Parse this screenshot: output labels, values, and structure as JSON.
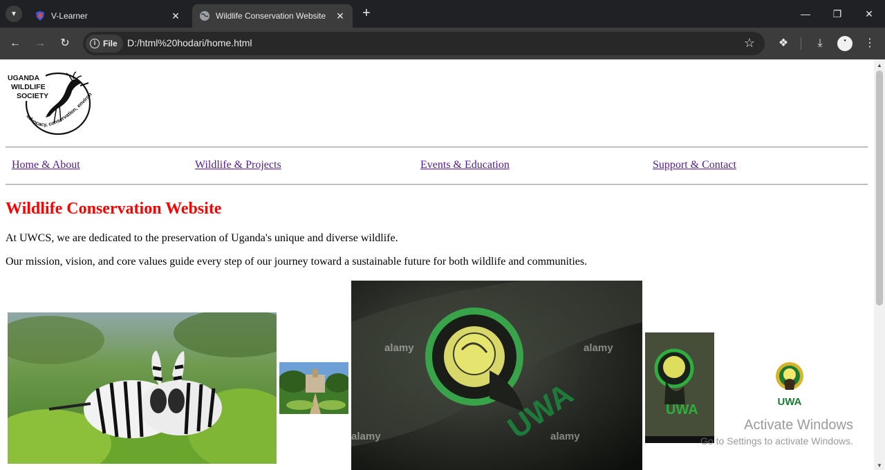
{
  "browser": {
    "tabs": [
      {
        "title": "V-Learner",
        "active": false
      },
      {
        "title": "Wildlife Conservation Website",
        "active": true
      }
    ],
    "address_chip": "File",
    "url": "D:/html%20hodari/home.html"
  },
  "site": {
    "logo": {
      "line1": "UGANDA",
      "line2": "WILDLIFE",
      "line3": "SOCIETY",
      "motto": "advocacy, conservation, environment"
    },
    "nav": [
      {
        "label": "Home & About"
      },
      {
        "label": "Wildlife & Projects"
      },
      {
        "label": "Events & Education"
      },
      {
        "label": "Support & Contact"
      }
    ],
    "heading": "Wildlife Conservation Website",
    "paragraphs": [
      "At UWCS, we are dedicated to the preservation of Uganda's unique and diverse wildlife.",
      "Our mission, vision, and core values guide every step of our journey toward a sustainable future for both wildlife and communities."
    ],
    "uwa_logo_text": "UWA",
    "badge_text": "UWA",
    "stock_watermark": "alamy"
  },
  "os_overlay": {
    "title": "Activate Windows",
    "subtitle": "Go to Settings to activate Windows."
  },
  "colors": {
    "heading": "#ff0000",
    "link_visited": "#551a8b",
    "chrome_dark": "#202124",
    "chrome_toolbar": "#3c3c3c"
  }
}
